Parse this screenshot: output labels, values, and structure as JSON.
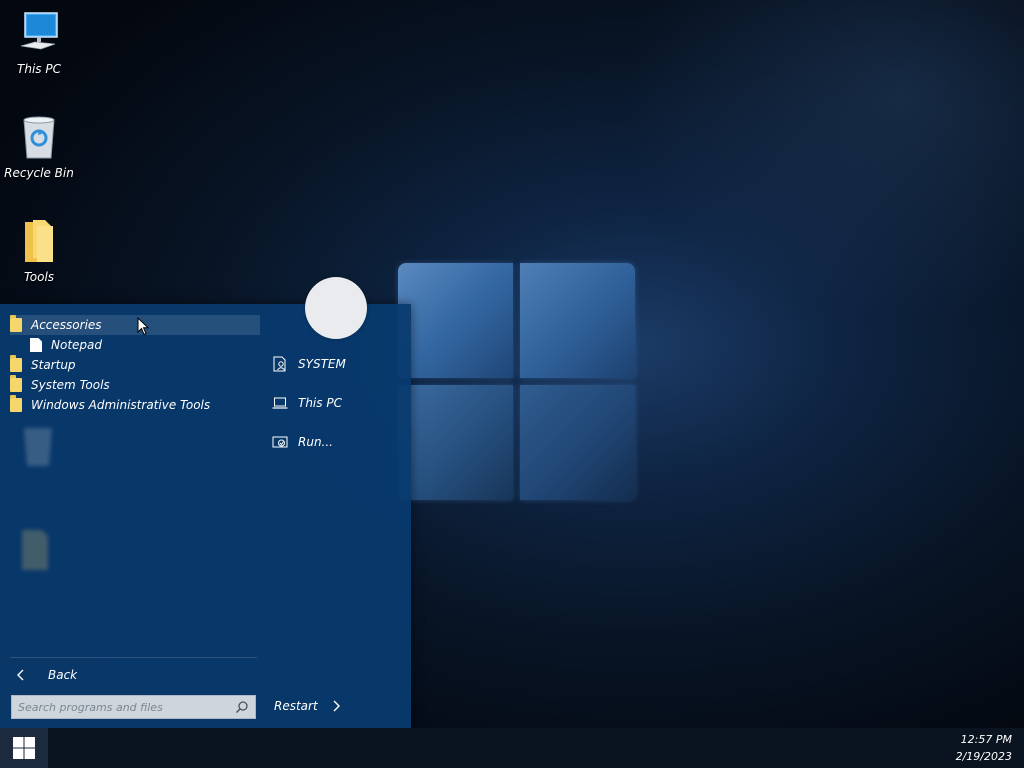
{
  "desktop": {
    "icons": [
      {
        "label": "This PC",
        "icon": "computer-icon"
      },
      {
        "label": "Recycle Bin",
        "icon": "recycle-bin-icon"
      },
      {
        "label": "Tools",
        "icon": "folder-icon"
      }
    ]
  },
  "start_menu": {
    "programs": [
      {
        "label": "Accessories",
        "icon": "folder-icon",
        "selected": true
      },
      {
        "label": "Notepad",
        "icon": "file-icon",
        "child": true
      },
      {
        "label": "Startup",
        "icon": "folder-icon"
      },
      {
        "label": "System Tools",
        "icon": "folder-icon"
      },
      {
        "label": "Windows Administrative Tools",
        "icon": "folder-icon"
      }
    ],
    "back_label": "Back",
    "search_placeholder": "Search programs and files",
    "right_items": [
      {
        "label": "SYSTEM",
        "icon": "user-folder-icon"
      },
      {
        "label": "This PC",
        "icon": "laptop-icon"
      },
      {
        "label": "Run...",
        "icon": "run-icon"
      }
    ],
    "restart_label": "Restart"
  },
  "taskbar": {
    "time": "12:57 PM",
    "date": "2/19/2023"
  },
  "colors": {
    "menu_bg": "#083a6e",
    "folder": "#f6d66a",
    "taskbar": "#0a1320"
  }
}
